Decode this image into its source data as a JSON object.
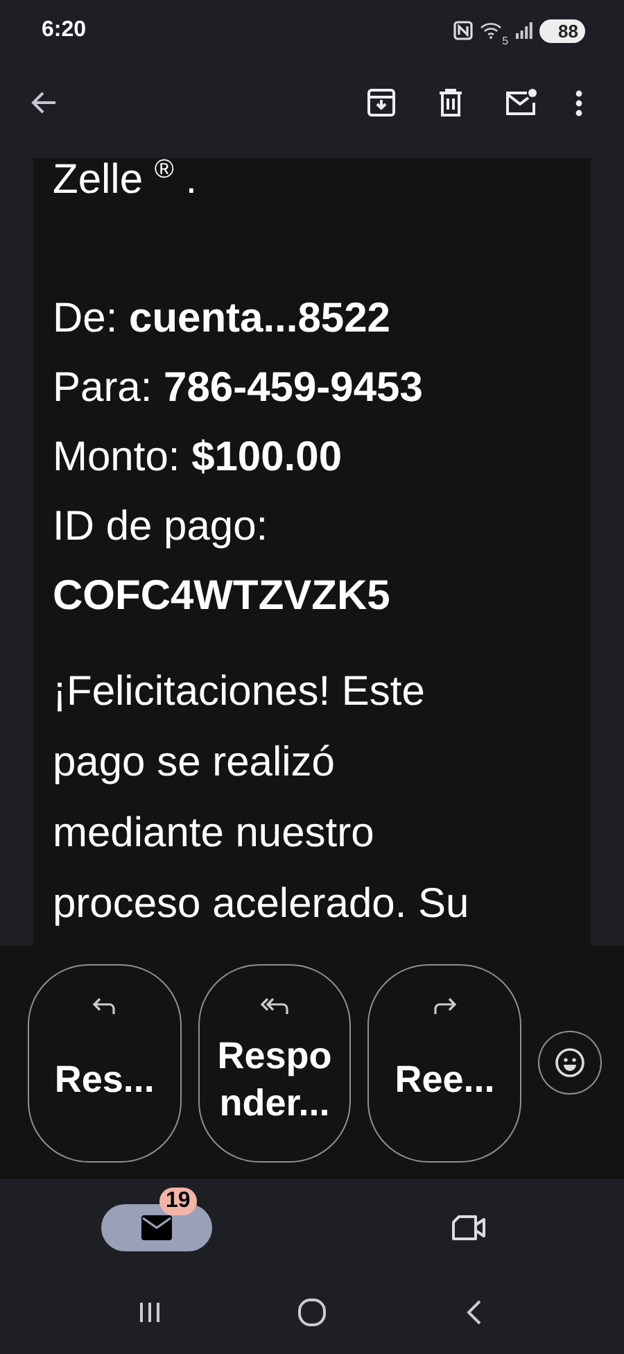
{
  "status_bar": {
    "time": "6:20",
    "wifi_label": "5",
    "battery": "88"
  },
  "message": {
    "intro": "Zelle $^{®}$ .",
    "details": [
      {
        "text": "De: **cuenta...8522**"
      },
      {
        "text": "Para: **786-459-9453**"
      },
      {
        "text": "Monto: **$100.00**"
      },
      {
        "text": "ID de pago:"
      },
      {
        "text": "**COFC4WTZVZK5**"
      }
    ],
    "paragraph": "¡Felicitaciones! Este pago se realizó mediante nuestro proceso acelerado. Su"
  },
  "reply_actions": [
    {
      "kind": "reply",
      "label": "Res..."
    },
    {
      "kind": "reply_all",
      "label": "Responder..."
    },
    {
      "kind": "forward",
      "label": "Ree..."
    }
  ],
  "bottom_nav": [
    {
      "kind": "mail",
      "badge": "19",
      "selected": true
    },
    {
      "kind": "meet",
      "selected": false
    }
  ]
}
